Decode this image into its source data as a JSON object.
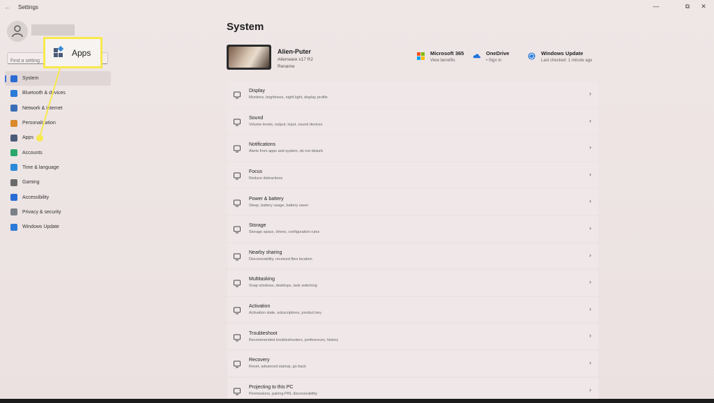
{
  "window": {
    "title": "Settings",
    "back_icon": "back-arrow-icon",
    "controls": [
      "minimize-icon",
      "maximize-icon",
      "close-icon"
    ]
  },
  "sidebar": {
    "search_placeholder": "Find a setting",
    "items": [
      {
        "label": "System",
        "icon": "monitor-icon",
        "color": "#2b6cd4",
        "active": true
      },
      {
        "label": "Bluetooth & devices",
        "icon": "bluetooth-icon",
        "color": "#2b7ad8"
      },
      {
        "label": "Network & internet",
        "icon": "wifi-icon",
        "color": "#3a6fb8"
      },
      {
        "label": "Personalization",
        "icon": "brush-icon",
        "color": "#d88a2b"
      },
      {
        "label": "Apps",
        "icon": "apps-icon",
        "color": "#4a5a78"
      },
      {
        "label": "Accounts",
        "icon": "person-icon",
        "color": "#2ba86b"
      },
      {
        "label": "Time & language",
        "icon": "globe-clock-icon",
        "color": "#2b8ad8"
      },
      {
        "label": "Gaming",
        "icon": "controller-icon",
        "color": "#6a6a6a"
      },
      {
        "label": "Accessibility",
        "icon": "accessibility-icon",
        "color": "#2b6cd4"
      },
      {
        "label": "Privacy & security",
        "icon": "shield-icon",
        "color": "#7a7f88"
      },
      {
        "label": "Windows Update",
        "icon": "sync-icon",
        "color": "#2b7ad8"
      }
    ]
  },
  "callout": {
    "label": "Apps",
    "icon": "apps-icon",
    "border_color": "#f7e94c"
  },
  "main": {
    "title": "System",
    "device": {
      "name": "Alien-Puter",
      "model": "Alienware x17 R2",
      "rename": "Rename"
    },
    "status": [
      {
        "title": "Microsoft 365",
        "sub": "View benefits",
        "icon": "microsoft-logo-icon"
      },
      {
        "title": "OneDrive",
        "sub": "• Sign in",
        "icon": "cloud-icon"
      },
      {
        "title": "Windows Update",
        "sub": "Last checked: 1 minute ago",
        "icon": "sync-icon"
      }
    ],
    "rows": [
      {
        "title": "Display",
        "sub": "Monitors, brightness, night light, display profile",
        "icon": "display-icon"
      },
      {
        "title": "Sound",
        "sub": "Volume levels, output, input, sound devices",
        "icon": "speaker-icon"
      },
      {
        "title": "Notifications",
        "sub": "Alerts from apps and system, do not disturb",
        "icon": "bell-icon"
      },
      {
        "title": "Focus",
        "sub": "Reduce distractions",
        "icon": "focus-icon"
      },
      {
        "title": "Power & battery",
        "sub": "Sleep, battery usage, battery saver",
        "icon": "power-icon"
      },
      {
        "title": "Storage",
        "sub": "Storage space, drives, configuration rules",
        "icon": "storage-icon"
      },
      {
        "title": "Nearby sharing",
        "sub": "Discoverability, received files location",
        "icon": "share-icon"
      },
      {
        "title": "Multitasking",
        "sub": "Snap windows, desktops, task switching",
        "icon": "multitask-icon"
      },
      {
        "title": "Activation",
        "sub": "Activation state, subscriptions, product key",
        "icon": "check-circle-icon"
      },
      {
        "title": "Troubleshoot",
        "sub": "Recommended troubleshooters, preferences, history",
        "icon": "wrench-icon"
      },
      {
        "title": "Recovery",
        "sub": "Reset, advanced startup, go back",
        "icon": "recovery-icon"
      },
      {
        "title": "Projecting to this PC",
        "sub": "Permissions, pairing PIN, discoverability",
        "icon": "projector-icon"
      }
    ]
  }
}
